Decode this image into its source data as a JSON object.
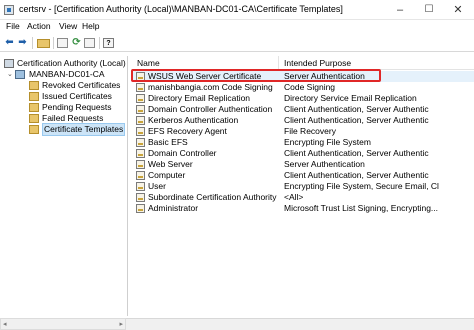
{
  "window": {
    "title": "certsrv - [Certification Authority (Local)\\MANBAN-DC01-CA\\Certificate Templates]",
    "controls": {
      "minimize": "–",
      "maximize": "☐",
      "close": "✕"
    }
  },
  "menu": {
    "items": [
      "File",
      "Action",
      "View",
      "Help"
    ]
  },
  "toolbar": {
    "buttons": [
      "back-arrow-icon",
      "forward-arrow-icon",
      "up-folder-icon",
      "show-hide-tree-icon",
      "refresh-icon",
      "export-list-icon",
      "help-icon"
    ],
    "glyphs": {
      "back": "⬅",
      "forward": "➡",
      "refresh": "⟳",
      "help": "?"
    }
  },
  "tree": {
    "root": "Certification Authority (Local)",
    "ca": "MANBAN-DC01-CA",
    "folders": [
      "Revoked Certificates",
      "Issued Certificates",
      "Pending Requests",
      "Failed Requests",
      "Certificate Templates"
    ],
    "selected": "Certificate Templates",
    "expander": "⌄"
  },
  "list": {
    "columns": {
      "name": "Name",
      "purpose": "Intended Purpose"
    },
    "rows": [
      {
        "name": "WSUS Web Server Certificate",
        "purpose": "Server Authentication"
      },
      {
        "name": "manishbangia.com Code Signing",
        "purpose": "Code Signing"
      },
      {
        "name": "Directory Email Replication",
        "purpose": "Directory Service Email Replication"
      },
      {
        "name": "Domain Controller Authentication",
        "purpose": "Client Authentication, Server Authentic"
      },
      {
        "name": "Kerberos Authentication",
        "purpose": "Client Authentication, Server Authentic"
      },
      {
        "name": "EFS Recovery Agent",
        "purpose": "File Recovery"
      },
      {
        "name": "Basic EFS",
        "purpose": "Encrypting File System"
      },
      {
        "name": "Domain Controller",
        "purpose": "Client Authentication, Server Authentic"
      },
      {
        "name": "Web Server",
        "purpose": "Server Authentication"
      },
      {
        "name": "Computer",
        "purpose": "Client Authentication, Server Authentic"
      },
      {
        "name": "User",
        "purpose": "Encrypting File System, Secure Email, Cl"
      },
      {
        "name": "Subordinate Certification Authority",
        "purpose": "<All>"
      },
      {
        "name": "Administrator",
        "purpose": "Microsoft Trust List Signing, Encrypting..."
      }
    ],
    "highlight_color": "#e02727"
  },
  "scrollbar": {
    "left": "◂",
    "right": "▸"
  }
}
